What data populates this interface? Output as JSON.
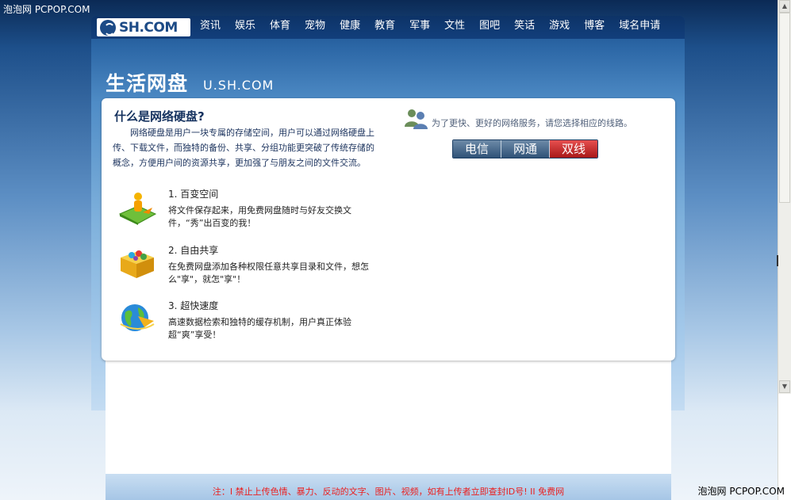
{
  "watermark": {
    "top_left": "泡泡网 PCPOP.COM",
    "bottom_right": "泡泡网 PCPOP.COM"
  },
  "header": {
    "logo_text": "SH.COM",
    "nav": [
      "资讯",
      "娱乐",
      "体育",
      "宠物",
      "健康",
      "教育",
      "军事",
      "文性",
      "图吧",
      "笑话",
      "游戏",
      "博客",
      "域名申请"
    ]
  },
  "banner": {
    "title": "生活网盘",
    "domain": "U.SH.COM"
  },
  "intro": {
    "heading": "什么是网络硬盘?",
    "body": "网络硬盘是用户一块专属的存储空间，用户可以通过网络硬盘上传、下载文件，而独特的备份、共享、分组功能更突破了传统存储的概念，方便用户间的资源共享，更加强了与朋友之间的文件交流。"
  },
  "features": [
    {
      "title": "1. 百变空间",
      "desc": "将文件保存起来，用免费网盘随时与好友交换文件，“秀”出百变的我！",
      "icon": "person-on-disk-icon"
    },
    {
      "title": "2. 自由共享",
      "desc": "在免费网盘添加各种权限任意共享目录和文件，想怎么\"享\"，就怎\"享\"！",
      "icon": "gift-box-icon"
    },
    {
      "title": "3. 超快速度",
      "desc": "高速数据检索和独特的缓存机制，用户真正体验超“爽”享受！",
      "icon": "globe-icon"
    }
  ],
  "line_select": {
    "prompt": "为了更快、更好的网络服务，请您选择相应的线路。",
    "options": [
      "电信",
      "网通",
      "双线"
    ],
    "selected": "双线"
  },
  "footer": {
    "notice": "注：I 禁止上传色情、暴力、反动的文字、图片、视频，如有上传者立即查封ID号! II 免费网"
  },
  "colors": {
    "accent": "#1c4a86",
    "active_line": "#c62828",
    "footer_text": "#ea1f1f"
  }
}
